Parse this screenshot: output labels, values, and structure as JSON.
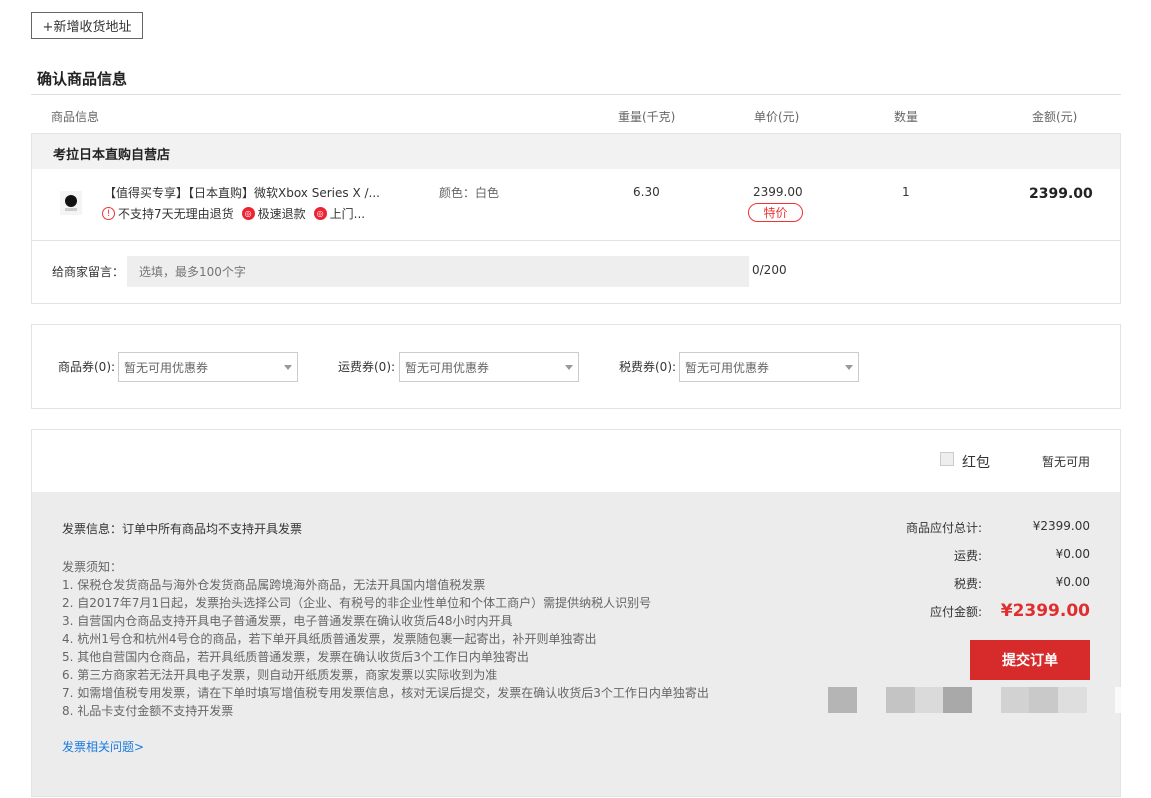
{
  "add_address_label": "+新增收货地址",
  "section_title": "确认商品信息",
  "columns": {
    "info": "商品信息",
    "weight": "重量(千克)",
    "unit_price": "单价(元)",
    "quantity": "数量",
    "amount": "金额(元)"
  },
  "store": {
    "name": "考拉日本直购自营店"
  },
  "product": {
    "icon": "xbox-thumbnail",
    "name": "【值得买专享】【日本直购】微软Xbox Series X /...",
    "attr": "颜色：白色",
    "weight": "6.30",
    "price": "2399.00",
    "badge": "特价",
    "qty": "1",
    "amount": "2399.00",
    "tags": [
      "不支持7天无理由退货",
      "极速退款",
      "上门..."
    ]
  },
  "message": {
    "label": "给商家留言：",
    "placeholder": "选填，最多100个字",
    "count": "0/200"
  },
  "coupons": [
    {
      "label": "商品券(0):",
      "value": "暂无可用优惠券"
    },
    {
      "label": "运费券(0):",
      "value": "暂无可用优惠券"
    },
    {
      "label": "税费券(0):",
      "value": "暂无可用优惠券"
    }
  ],
  "red_packet": {
    "label": "红包",
    "status": "暂无可用"
  },
  "invoice": {
    "info": "发票信息：订单中所有商品均不支持开具发票",
    "notes_title": "发票须知：",
    "notes": [
      "1. 保税仓发货商品与海外仓发货商品属跨境海外商品，无法开具国内增值税发票",
      "2. 自2017年7月1日起，发票抬头选择公司（企业、有税号的非企业性单位和个体工商户）需提供纳税人识别号",
      "3. 自营国内仓商品支持开具电子普通发票，电子普通发票在确认收货后48小时内开具",
      "4. 杭州1号仓和杭州4号仓的商品，若下单开具纸质普通发票，发票随包裹一起寄出，补开则单独寄出",
      "5. 其他自营国内仓商品，若开具纸质普通发票，发票在确认收货后3个工作日内单独寄出",
      "6. 第三方商家若无法开具电子发票，则自动开纸质发票，商家发票以实际收到为准",
      "7. 如需增值税专用发票，请在下单时填写增值税专用发票信息，核对无误后提交，发票在确认收货后3个工作日内单独寄出",
      "8. 礼品卡支付金额不支持开发票"
    ],
    "link": "发票相关问题>"
  },
  "summary": {
    "goods_label": "商品应付总计:",
    "goods_value": "¥2399.00",
    "shipping_label": "运费:",
    "shipping_value": "¥0.00",
    "tax_label": "税费:",
    "tax_value": "¥0.00",
    "total_label": "应付金额:",
    "total_value": "¥2399.00"
  },
  "submit_label": "提交订单",
  "colors": {
    "accent": "#d72a2a",
    "link": "#1a7be0"
  }
}
